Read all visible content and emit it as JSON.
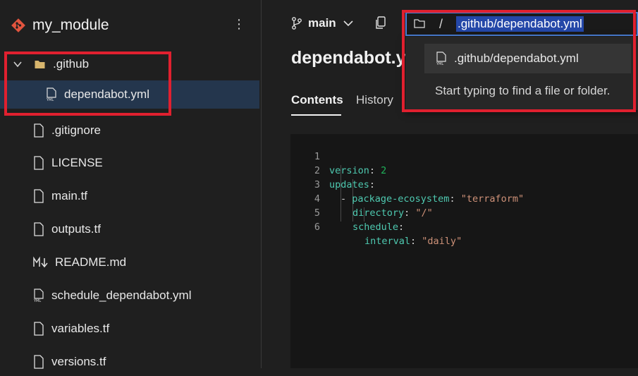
{
  "repo": {
    "name": "my_module",
    "more_label": "⋮"
  },
  "tree": {
    "github_folder": ".github",
    "dependabot_file": "dependabot.yml",
    "files": [
      ".gitignore",
      "LICENSE",
      "main.tf",
      "outputs.tf",
      "README.md",
      "schedule_dependabot.yml",
      "variables.tf",
      "versions.tf"
    ]
  },
  "toolbar": {
    "branch": "main",
    "path_separator": "/",
    "path_value": ".github/dependabot.yml"
  },
  "dropdown": {
    "result": ".github/dependabot.yml",
    "hint": "Start typing to find a file or folder."
  },
  "file": {
    "title": "dependabot.yml"
  },
  "tabs": {
    "contents": "Contents",
    "history": "History"
  },
  "code": {
    "lines": [
      {
        "num": "1",
        "key": "version",
        "sep": ": ",
        "val": "2"
      },
      {
        "num": "2",
        "key": "updates",
        "sep": ":"
      },
      {
        "num": "3",
        "dash": "- ",
        "key": "package-ecosystem",
        "sep": ": ",
        "val": "\"terraform\""
      },
      {
        "num": "4",
        "key": "directory",
        "sep": ": ",
        "val": "\"/\""
      },
      {
        "num": "5",
        "key": "schedule",
        "sep": ":"
      },
      {
        "num": "6",
        "key": "interval",
        "sep": ": ",
        "val": "\"daily\""
      }
    ]
  },
  "colors": {
    "accent_box": "#e0202f",
    "selected_row": "#24364d",
    "keyword": "#4ec9b0",
    "string": "#ce9178",
    "number": "#1fb35a"
  }
}
